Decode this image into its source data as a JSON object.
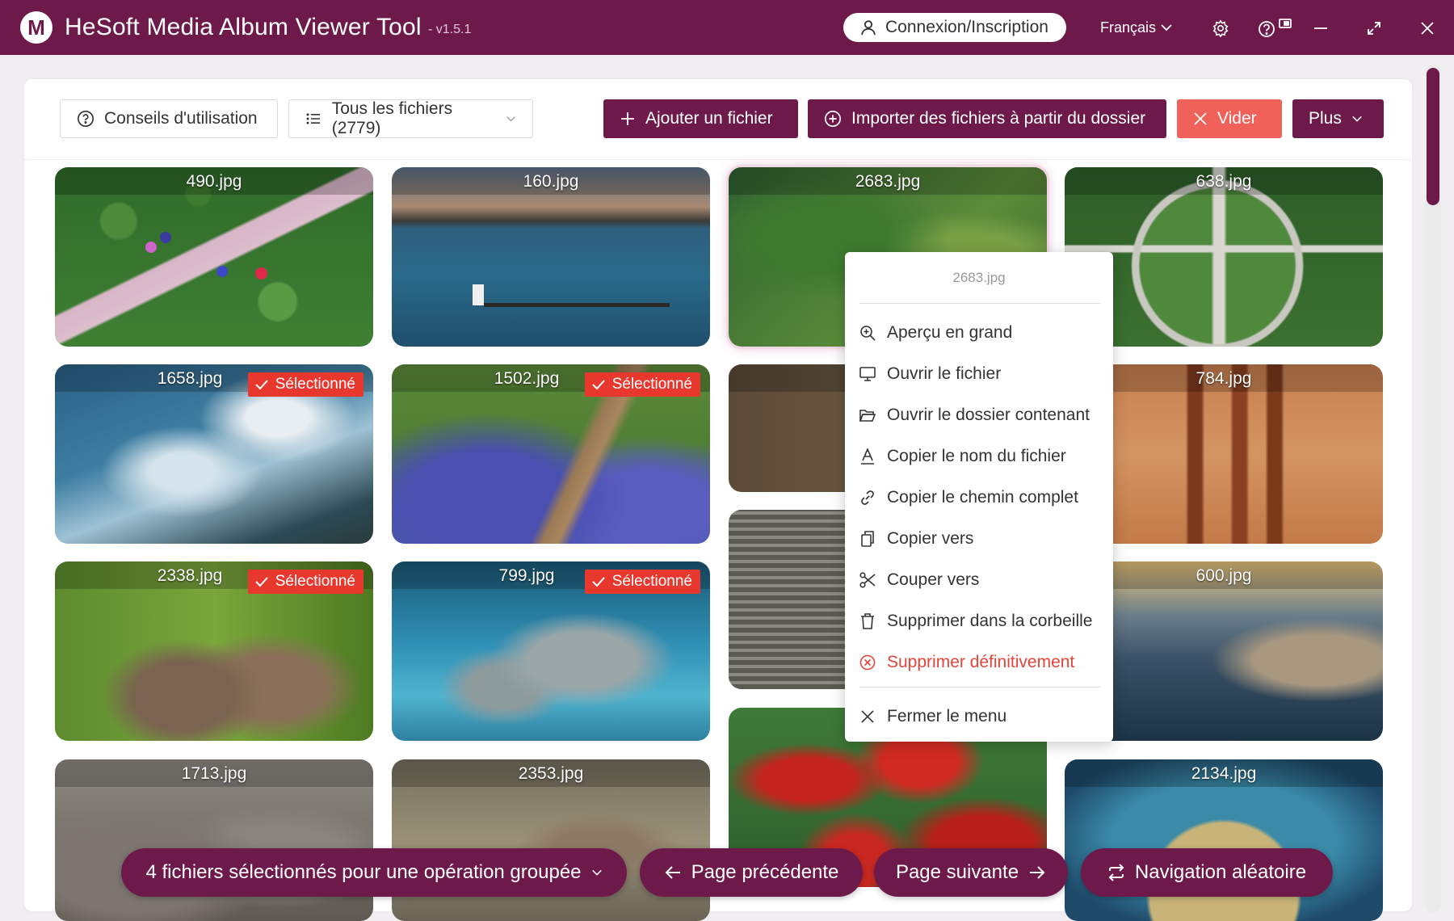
{
  "titlebar": {
    "logo_letter": "M",
    "app_title": "HeSoft Media Album Viewer Tool",
    "version": "- v1.5.1",
    "login_label": "Connexion/Inscription",
    "language": "Français"
  },
  "toolbar": {
    "tips_label": "Conseils d'utilisation",
    "filter_label": "Tous les fichiers (2779)",
    "add_file_label": "Ajouter un fichier",
    "import_folder_label": "Importer des fichiers à partir du dossier",
    "clear_label": "Vider",
    "more_label": "Plus"
  },
  "selected_badge": "Sélectionné",
  "colors": {
    "brand": "#6d1a4a",
    "danger": "#f0615a",
    "badge": "#e8382e"
  },
  "grid": [
    {
      "name": "490.jpg",
      "selected": false
    },
    {
      "name": "160.jpg",
      "selected": false
    },
    {
      "name": "2683.jpg",
      "selected": false
    },
    {
      "name": "638.jpg",
      "selected": false
    },
    {
      "name": "1658.jpg",
      "selected": true
    },
    {
      "name": "1502.jpg",
      "selected": true
    },
    {
      "name": "784.jpg",
      "selected": false
    },
    {
      "name": "2338.jpg",
      "selected": true
    },
    {
      "name": "799.jpg",
      "selected": true
    },
    {
      "name": "600.jpg",
      "selected": false
    },
    {
      "name": "1713.jpg",
      "selected": false
    },
    {
      "name": "2353.jpg",
      "selected": false
    },
    {
      "name": "2134.jpg",
      "selected": false
    }
  ],
  "context_menu": {
    "title": "2683.jpg",
    "items": [
      {
        "label": "Aperçu en grand",
        "icon": "zoom-in-icon"
      },
      {
        "label": "Ouvrir le fichier",
        "icon": "monitor-icon"
      },
      {
        "label": "Ouvrir le dossier contenant",
        "icon": "folder-open-icon"
      },
      {
        "label": "Copier le nom du fichier",
        "icon": "text-icon"
      },
      {
        "label": "Copier le chemin complet",
        "icon": "link-icon"
      },
      {
        "label": "Copier vers",
        "icon": "copy-icon"
      },
      {
        "label": "Couper vers",
        "icon": "scissors-icon"
      },
      {
        "label": "Supprimer dans la corbeille",
        "icon": "trash-icon"
      },
      {
        "label": "Supprimer définitivement",
        "icon": "close-circle-icon"
      }
    ],
    "close_label": "Fermer le menu"
  },
  "bottom": {
    "batch_label": "4 fichiers sélectionnés pour une opération groupée",
    "prev_label": "Page précédente",
    "next_label": "Page suivante",
    "random_label": "Navigation aléatoire"
  }
}
